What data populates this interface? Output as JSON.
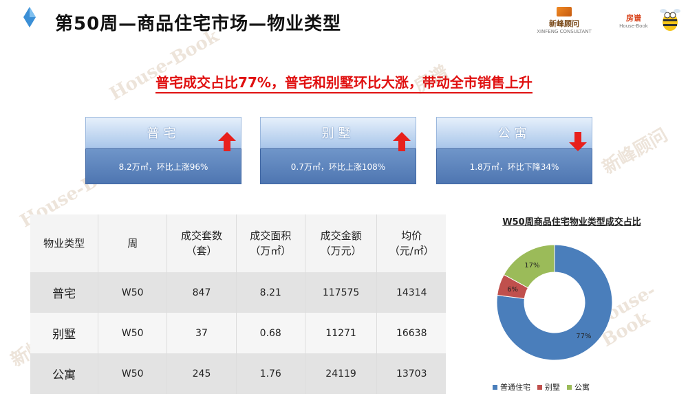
{
  "header": {
    "title": "第50周—商品住宅市场—物业类型",
    "brand_a_name": "新峰顾问",
    "brand_a_sub": "XINFENG CONSULTANT",
    "brand_b_name": "房谱",
    "brand_b_sub": "House-Book"
  },
  "headline": "普宅成交占比77%，普宅和别墅环比大涨，带动全市销售上升",
  "cards": [
    {
      "name": "普宅",
      "detail": "8.2万㎡，环比上涨96%",
      "trend": "up"
    },
    {
      "name": "别墅",
      "detail": "0.7万㎡，环比上涨108%",
      "trend": "up"
    },
    {
      "name": "公寓",
      "detail": "1.8万㎡，环比下降34%",
      "trend": "down"
    }
  ],
  "table": {
    "headers": [
      [
        "物业类型"
      ],
      [
        "周"
      ],
      [
        "成交套数",
        "（套）"
      ],
      [
        "成交面积",
        "（万㎡）"
      ],
      [
        "成交金额",
        "（万元）"
      ],
      [
        "均价",
        "（元/㎡）"
      ]
    ],
    "rows": [
      [
        "普宅",
        "W50",
        "847",
        "8.21",
        "117575",
        "14314"
      ],
      [
        "别墅",
        "W50",
        "37",
        "0.68",
        "11271",
        "16638"
      ],
      [
        "公寓",
        "W50",
        "245",
        "1.76",
        "24119",
        "13703"
      ]
    ]
  },
  "chart_data": {
    "type": "pie",
    "title": "W50周商品住宅物业类型成交占比",
    "categories": [
      "普通住宅",
      "别墅",
      "公寓"
    ],
    "values": [
      77,
      6,
      17
    ],
    "labels": [
      "77%",
      "6%",
      "17%"
    ],
    "colors": [
      "#4a7ebb",
      "#c0504d",
      "#9bbb59"
    ],
    "legend_position": "bottom"
  },
  "watermarks": [
    "房谱",
    "House-Book",
    "新峰顾问"
  ]
}
